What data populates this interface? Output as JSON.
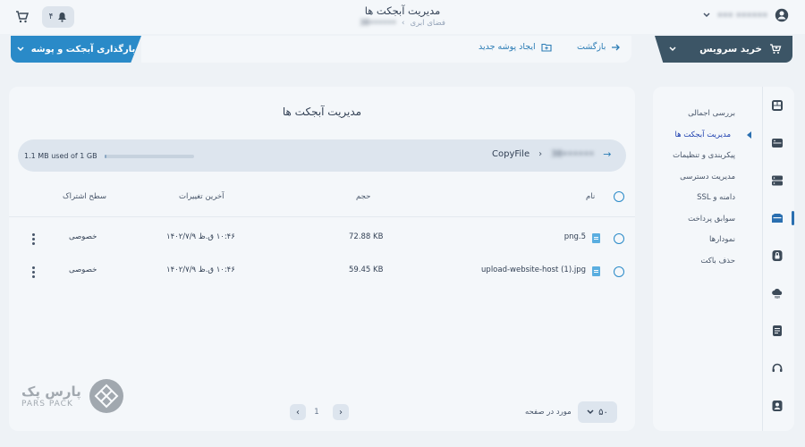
{
  "header": {
    "title": "مدیریت آبجکت ها",
    "breadcrumb": {
      "root": "فضای ابری",
      "separator": "›",
      "current": "••••••38"
    },
    "notification_count": "۴",
    "user_name": "••• ••••••",
    "icons": {
      "cart": "cart-icon",
      "bell": "bell-icon",
      "user": "user-avatar-icon",
      "chevron": "chevron-down-icon"
    }
  },
  "toolbar": {
    "upload_label": "بارگذاری آبجکت و پوشه",
    "buy_label": "خرید سرویس",
    "back_label": "بازگشت",
    "new_folder_label": "ایجاد پوشه جدید"
  },
  "sidebar": {
    "items": [
      {
        "label": "بررسی اجمالی",
        "active": false
      },
      {
        "label": "مدیریت آبجکت ها",
        "active": true
      },
      {
        "label": "پیکربندی و تنظیمات",
        "active": false
      },
      {
        "label": "مدیریت دسترسی",
        "active": false
      },
      {
        "label": "دامنه و SSL",
        "active": false
      },
      {
        "label": "سوابق پرداخت",
        "active": false
      },
      {
        "label": "نمودارها",
        "active": false
      },
      {
        "label": "حذف باکت",
        "active": false
      }
    ],
    "rail_icons": [
      "dashboard-icon",
      "server-icon",
      "database-icon",
      "storage-icon",
      "lock-icon",
      "cloud-icon",
      "document-icon",
      "support-icon",
      "profile-icon"
    ]
  },
  "main": {
    "title": "مدیریت آبجکت ها",
    "storage_usage": "1.1 MB used of 1 GB",
    "storage_fraction": 0.0011,
    "path": {
      "bucket": "••••••38",
      "folder": "CopyFile"
    },
    "columns": {
      "name": "نام",
      "size": "حجم",
      "modified": "آخرین تغییرات",
      "access": "سطح اشتراک"
    },
    "rows": [
      {
        "name": "png.5",
        "size": "72.88 KB",
        "modified": "۱۰:۴۶ ق.ظ ۱۴۰۲/۷/۹",
        "access": "خصوصی"
      },
      {
        "name": "upload-website-host (1).jpg",
        "size": "59.45 KB",
        "modified": "۱۰:۴۶ ق.ظ ۱۴۰۲/۷/۹",
        "access": "خصوصی"
      }
    ]
  },
  "pagination": {
    "per_page": "۵۰",
    "per_page_label": "مورد در صفحه",
    "page": "1"
  },
  "logo": {
    "fa": "پارس پک",
    "en": "PARS PACK"
  }
}
